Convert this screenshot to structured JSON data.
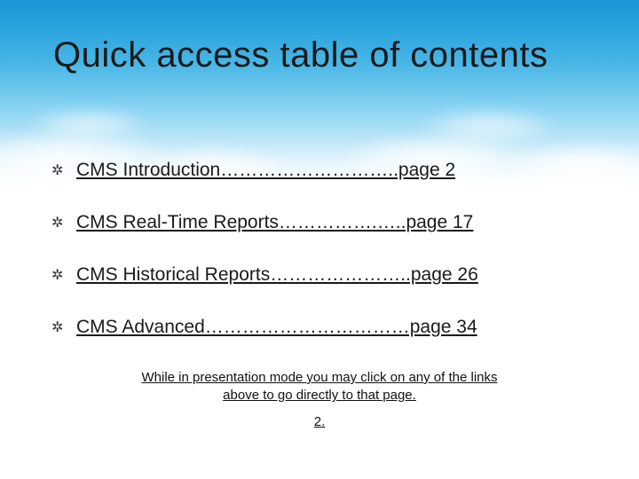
{
  "title": "Quick access table of contents",
  "toc": [
    {
      "text": "CMS Introduction………………………..page  2"
    },
    {
      "text": "CMS Real-Time Reports…………….…..page 17"
    },
    {
      "text": "CMS Historical Reports…………………..page 26"
    },
    {
      "text": "CMS Advanced……………………………page 34"
    }
  ],
  "note": " While in presentation mode you may click on any of the links above to go directly to that page.",
  "page_number": "2."
}
